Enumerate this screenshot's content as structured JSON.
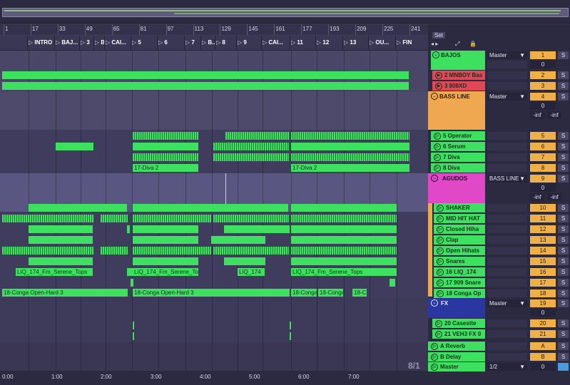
{
  "ruler": {
    "bars": [
      "1",
      "17",
      "33",
      "49",
      "65",
      "81",
      "97",
      "113",
      "129",
      "145",
      "161",
      "177",
      "193",
      "209",
      "225",
      "241"
    ]
  },
  "locators": [
    "INTRO",
    "BAJ...",
    "3",
    "B...",
    "CAI...",
    "5",
    "6",
    "7",
    "B...",
    "8",
    "9",
    "CAI...",
    "11",
    "12",
    "13",
    "OU...",
    "FIN"
  ],
  "set": {
    "label": "Set"
  },
  "clips": {
    "diva17": "17-Diva 2",
    "liq": "LIQ_174_Fm_Serene_Tops",
    "liq_short": "LIQ_174",
    "conga": "18-Conga Open-Hard 3",
    "conga_short": "18-Conga",
    "conga_tiny": "18-C"
  },
  "time_ruler": [
    "0:00",
    "1:00",
    "2:00",
    "3:00",
    "4:00",
    "5:00",
    "6:00",
    "7:00"
  ],
  "time_signature": "8/1",
  "tracks": {
    "bajos": {
      "name": "BAJOS",
      "route": "Master",
      "num": "1",
      "vol": "0"
    },
    "mnboy": {
      "name": "2 MNBOY Bas",
      "num": "2"
    },
    "x808": {
      "name": "3 808XD",
      "num": "3"
    },
    "bassline": {
      "name": "BASS LINE",
      "route": "Master",
      "num": "4",
      "vol": "0",
      "inf1": "-inf",
      "inf2": "-inf"
    },
    "operator": {
      "name": "5 Operator",
      "num": "5"
    },
    "serum": {
      "name": "6 Serum",
      "num": "6"
    },
    "diva7": {
      "name": "7 Diva",
      "num": "7"
    },
    "diva8": {
      "name": "8 Diva",
      "num": "8"
    },
    "agudos": {
      "name": "AGUDOS",
      "route": "BASS LINE",
      "num": "9",
      "vol": "0",
      "inf1": "-inf",
      "inf2": "-inf"
    },
    "shaker": {
      "name": "SHAKER",
      "num": "10"
    },
    "midhit": {
      "name": "MID HIT HAT",
      "num": "11"
    },
    "closedhiha": {
      "name": "Closed Hiha",
      "num": "12"
    },
    "clap": {
      "name": "Clap",
      "num": "13"
    },
    "openhihats": {
      "name": "Open Hihats",
      "num": "14"
    },
    "snares": {
      "name": "Snares",
      "num": "15"
    },
    "liq174": {
      "name": "16 LIQ_174",
      "num": "16"
    },
    "snare909": {
      "name": "17 909 Snare",
      "num": "17"
    },
    "congaop": {
      "name": "18 Conga Op",
      "num": "18"
    },
    "fx": {
      "name": "FX",
      "route": "Master",
      "num": "19",
      "vol": "0"
    },
    "casestte": {
      "name": "20 Casestte",
      "num": "20"
    },
    "veh3": {
      "name": "21 VEH3 FX 0",
      "num": "21"
    },
    "areverb": {
      "name": "A Reverb",
      "num": "A"
    },
    "bdelay": {
      "name": "B Delay",
      "num": "B"
    },
    "master": {
      "name": "Master",
      "route": "1/2",
      "vol": "0"
    }
  },
  "solo_label": "S",
  "colors": {
    "clip_green": "#3ee060",
    "bajos_red": "#e04858",
    "bassline_orange": "#f0a850",
    "agudos_pink": "#e048c8",
    "fx_blue": "#2838a0",
    "number_orange": "#f0b048"
  }
}
